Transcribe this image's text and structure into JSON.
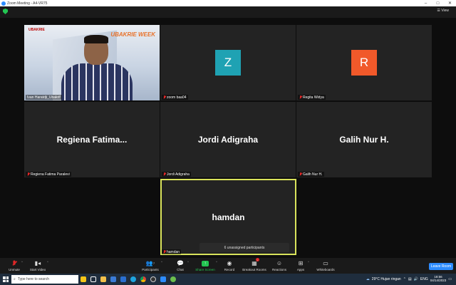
{
  "window": {
    "title": "Zoom Meeting - A4-VR75"
  },
  "top": {
    "view_label": "View"
  },
  "tiles": [
    {
      "type": "video",
      "name": "Ivan Haratdji_Ubakrif",
      "logo_text": "UBAKRIE",
      "banner_text": "UBAKRIE WEEK"
    },
    {
      "type": "avatar",
      "name": "zoom baa04",
      "initial": "Z",
      "avatar_color": "#1fa2b3"
    },
    {
      "type": "avatar",
      "name": "Regita Widya",
      "initial": "R",
      "avatar_color": "#f1592a"
    },
    {
      "type": "text",
      "display": "Regiena  Fatima...",
      "name": "Regiena Fatima Paralevi"
    },
    {
      "type": "text",
      "display": "Jordi Adigraha",
      "name": "Jordi Adigraha"
    },
    {
      "type": "text",
      "display": "Galih Nur H.",
      "name": "Galih Nur H."
    },
    {
      "type": "text",
      "display": "hamdan",
      "name": "hamdan"
    }
  ],
  "unassigned_text": "6 unassigned participants",
  "toolbar": {
    "unmute": "Unmute",
    "start_video": "Start Video",
    "participants": "Participants",
    "participants_count": "7",
    "chat": "Chat",
    "share_screen": "Share Screen",
    "record": "Record",
    "breakout_rooms": "Breakout Rooms",
    "reactions": "Reactions",
    "apps": "Apps",
    "whiteboards": "Whiteboards",
    "leave": "Leave Room"
  },
  "taskbar": {
    "search_placeholder": "Type here to search",
    "weather": "29°C  Hujan ringan",
    "language": "ENG",
    "time": "18:56",
    "date": "04/14/2023"
  },
  "colors": {
    "accent": "#2d8cff",
    "green": "#23c552",
    "active_border": "#d9e35b",
    "mute_red": "#e02828"
  }
}
